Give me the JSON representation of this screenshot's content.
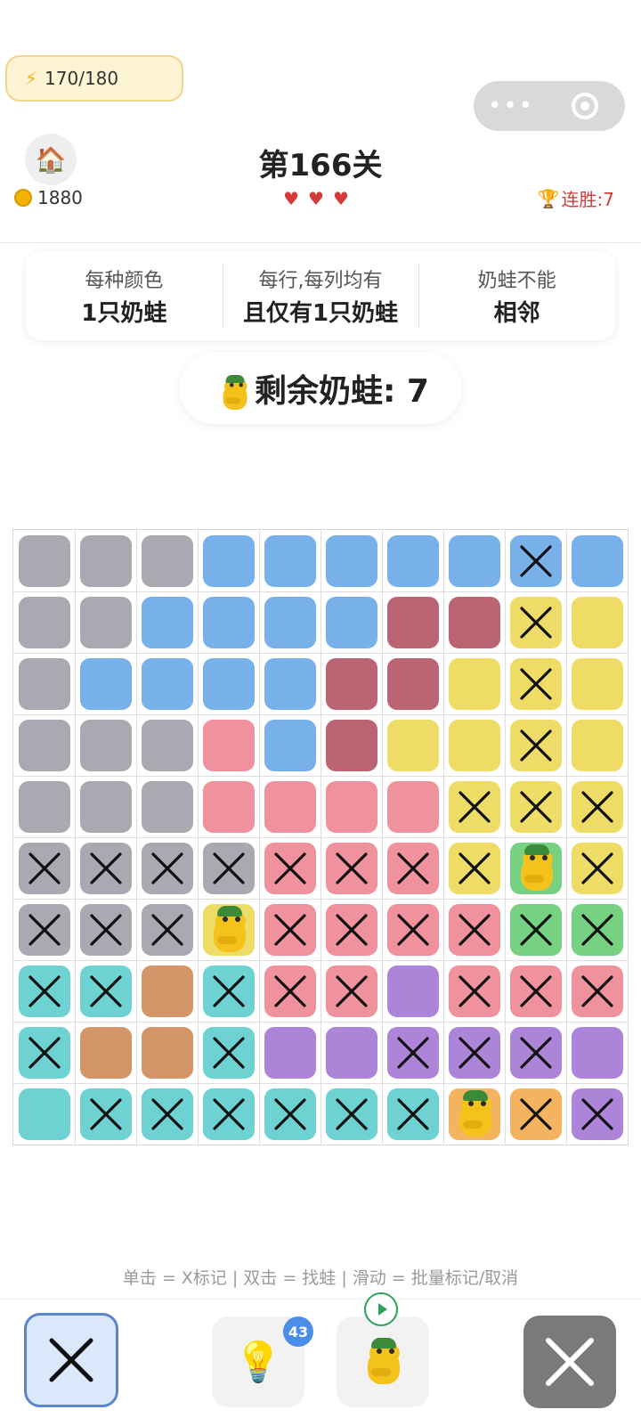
{
  "energy": {
    "text": "170/180",
    "icon": "lightning-icon"
  },
  "capsule": {
    "more": "•••",
    "close": "target-icon"
  },
  "header": {
    "home_icon": "🏠",
    "coins": "1880",
    "level": "第166关",
    "hearts": "♥♥♥",
    "streak": "连胜:7"
  },
  "rules": [
    {
      "line1": "每种颜色",
      "line2": "1只奶蛙"
    },
    {
      "line1": "每行,每列均有",
      "line2": "且仅有1只奶蛙"
    },
    {
      "line1": "奶蛙不能",
      "line2": "相邻"
    }
  ],
  "remaining": "剩余奶蛙: 7",
  "colors": {
    "G": "#a9a9b1",
    "B": "#78b1ea",
    "R": "#bb6574",
    "Y": "#eedc67",
    "P": "#ef929e",
    "K": "#77d183",
    "C": "#6dd2d1",
    "O": "#d49569",
    "V": "#ad85d8",
    "A": "#f4b35f"
  },
  "board": {
    "size": 10,
    "cells": [
      [
        "G",
        "G",
        "G",
        "B",
        "B",
        "B",
        "B",
        "B",
        "B",
        "B"
      ],
      [
        "G",
        "G",
        "B",
        "B",
        "B",
        "B",
        "R",
        "R",
        "Y",
        "Y"
      ],
      [
        "G",
        "B",
        "B",
        "B",
        "B",
        "R",
        "R",
        "Y",
        "Y",
        "Y"
      ],
      [
        "G",
        "G",
        "G",
        "P",
        "B",
        "R",
        "Y",
        "Y",
        "Y",
        "Y"
      ],
      [
        "G",
        "G",
        "G",
        "P",
        "P",
        "P",
        "P",
        "Y",
        "Y",
        "Y"
      ],
      [
        "G",
        "G",
        "G",
        "G",
        "P",
        "P",
        "P",
        "Y",
        "K",
        "Y"
      ],
      [
        "G",
        "G",
        "G",
        "Y",
        "P",
        "P",
        "P",
        "P",
        "K",
        "K"
      ],
      [
        "C",
        "C",
        "O",
        "C",
        "P",
        "P",
        "V",
        "P",
        "P",
        "P"
      ],
      [
        "C",
        "O",
        "O",
        "C",
        "V",
        "V",
        "V",
        "V",
        "V",
        "V"
      ],
      [
        "C",
        "C",
        "C",
        "C",
        "C",
        "C",
        "C",
        "A",
        "A",
        "V"
      ]
    ],
    "marks": [
      [
        "",
        "",
        "",
        "",
        "",
        "",
        "",
        "",
        "x",
        ""
      ],
      [
        "",
        "",
        "",
        "",
        "",
        "",
        "",
        "",
        "x",
        ""
      ],
      [
        "",
        "",
        "",
        "",
        "",
        "",
        "",
        "",
        "x",
        ""
      ],
      [
        "",
        "",
        "",
        "",
        "",
        "",
        "",
        "",
        "x",
        ""
      ],
      [
        "",
        "",
        "",
        "",
        "",
        "",
        "",
        "x",
        "x",
        "x"
      ],
      [
        "x",
        "x",
        "x",
        "x",
        "x",
        "x",
        "x",
        "x",
        "f",
        "x"
      ],
      [
        "x",
        "x",
        "x",
        "f",
        "x",
        "x",
        "x",
        "x",
        "x",
        "x"
      ],
      [
        "x",
        "x",
        "",
        "x",
        "x",
        "x",
        "",
        "x",
        "x",
        "x"
      ],
      [
        "x",
        "",
        "",
        "x",
        "",
        "",
        "x",
        "x",
        "x",
        ""
      ],
      [
        "",
        "x",
        "x",
        "x",
        "x",
        "x",
        "x",
        "f",
        "x",
        "x"
      ]
    ]
  },
  "instructions": "单击 = X标记 | 双击 = 找蛙 | 滑动 = 批量标记/取消",
  "buttons": {
    "mark": "x-mark-icon",
    "hint_icon": "💡",
    "hint_count": "43",
    "frog": "frog-icon",
    "close": "close-icon"
  }
}
